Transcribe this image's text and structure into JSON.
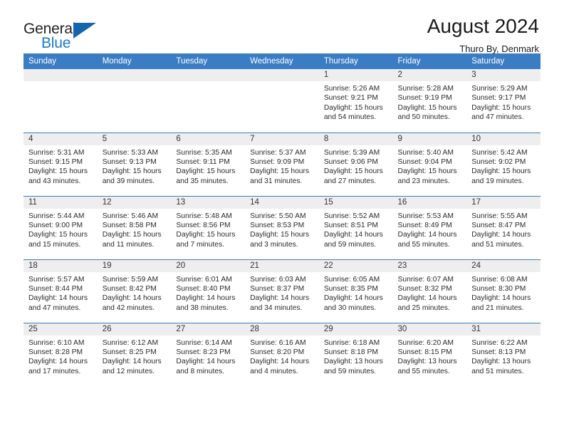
{
  "brand": {
    "name_top": "General",
    "name_bottom": "Blue",
    "accent_color": "#1c7ac9",
    "triangle_color": "#1565ad"
  },
  "header": {
    "title": "August 2024",
    "subtitle": "Thuro By, Denmark"
  },
  "calendar": {
    "header_bg": "#3b7dc4",
    "header_text_color": "#ffffff",
    "daynum_bg": "#eeeeee",
    "weekdays": [
      "Sunday",
      "Monday",
      "Tuesday",
      "Wednesday",
      "Thursday",
      "Friday",
      "Saturday"
    ],
    "weeks": [
      [
        {
          "day": "",
          "empty": true
        },
        {
          "day": "",
          "empty": true
        },
        {
          "day": "",
          "empty": true
        },
        {
          "day": "",
          "empty": true
        },
        {
          "day": "1",
          "sunrise": "Sunrise: 5:26 AM",
          "sunset": "Sunset: 9:21 PM",
          "daylight_line1": "Daylight: 15 hours",
          "daylight_line2": "and 54 minutes."
        },
        {
          "day": "2",
          "sunrise": "Sunrise: 5:28 AM",
          "sunset": "Sunset: 9:19 PM",
          "daylight_line1": "Daylight: 15 hours",
          "daylight_line2": "and 50 minutes."
        },
        {
          "day": "3",
          "sunrise": "Sunrise: 5:29 AM",
          "sunset": "Sunset: 9:17 PM",
          "daylight_line1": "Daylight: 15 hours",
          "daylight_line2": "and 47 minutes."
        }
      ],
      [
        {
          "day": "4",
          "sunrise": "Sunrise: 5:31 AM",
          "sunset": "Sunset: 9:15 PM",
          "daylight_line1": "Daylight: 15 hours",
          "daylight_line2": "and 43 minutes."
        },
        {
          "day": "5",
          "sunrise": "Sunrise: 5:33 AM",
          "sunset": "Sunset: 9:13 PM",
          "daylight_line1": "Daylight: 15 hours",
          "daylight_line2": "and 39 minutes."
        },
        {
          "day": "6",
          "sunrise": "Sunrise: 5:35 AM",
          "sunset": "Sunset: 9:11 PM",
          "daylight_line1": "Daylight: 15 hours",
          "daylight_line2": "and 35 minutes."
        },
        {
          "day": "7",
          "sunrise": "Sunrise: 5:37 AM",
          "sunset": "Sunset: 9:09 PM",
          "daylight_line1": "Daylight: 15 hours",
          "daylight_line2": "and 31 minutes."
        },
        {
          "day": "8",
          "sunrise": "Sunrise: 5:39 AM",
          "sunset": "Sunset: 9:06 PM",
          "daylight_line1": "Daylight: 15 hours",
          "daylight_line2": "and 27 minutes."
        },
        {
          "day": "9",
          "sunrise": "Sunrise: 5:40 AM",
          "sunset": "Sunset: 9:04 PM",
          "daylight_line1": "Daylight: 15 hours",
          "daylight_line2": "and 23 minutes."
        },
        {
          "day": "10",
          "sunrise": "Sunrise: 5:42 AM",
          "sunset": "Sunset: 9:02 PM",
          "daylight_line1": "Daylight: 15 hours",
          "daylight_line2": "and 19 minutes."
        }
      ],
      [
        {
          "day": "11",
          "sunrise": "Sunrise: 5:44 AM",
          "sunset": "Sunset: 9:00 PM",
          "daylight_line1": "Daylight: 15 hours",
          "daylight_line2": "and 15 minutes."
        },
        {
          "day": "12",
          "sunrise": "Sunrise: 5:46 AM",
          "sunset": "Sunset: 8:58 PM",
          "daylight_line1": "Daylight: 15 hours",
          "daylight_line2": "and 11 minutes."
        },
        {
          "day": "13",
          "sunrise": "Sunrise: 5:48 AM",
          "sunset": "Sunset: 8:56 PM",
          "daylight_line1": "Daylight: 15 hours",
          "daylight_line2": "and 7 minutes."
        },
        {
          "day": "14",
          "sunrise": "Sunrise: 5:50 AM",
          "sunset": "Sunset: 8:53 PM",
          "daylight_line1": "Daylight: 15 hours",
          "daylight_line2": "and 3 minutes."
        },
        {
          "day": "15",
          "sunrise": "Sunrise: 5:52 AM",
          "sunset": "Sunset: 8:51 PM",
          "daylight_line1": "Daylight: 14 hours",
          "daylight_line2": "and 59 minutes."
        },
        {
          "day": "16",
          "sunrise": "Sunrise: 5:53 AM",
          "sunset": "Sunset: 8:49 PM",
          "daylight_line1": "Daylight: 14 hours",
          "daylight_line2": "and 55 minutes."
        },
        {
          "day": "17",
          "sunrise": "Sunrise: 5:55 AM",
          "sunset": "Sunset: 8:47 PM",
          "daylight_line1": "Daylight: 14 hours",
          "daylight_line2": "and 51 minutes."
        }
      ],
      [
        {
          "day": "18",
          "sunrise": "Sunrise: 5:57 AM",
          "sunset": "Sunset: 8:44 PM",
          "daylight_line1": "Daylight: 14 hours",
          "daylight_line2": "and 47 minutes."
        },
        {
          "day": "19",
          "sunrise": "Sunrise: 5:59 AM",
          "sunset": "Sunset: 8:42 PM",
          "daylight_line1": "Daylight: 14 hours",
          "daylight_line2": "and 42 minutes."
        },
        {
          "day": "20",
          "sunrise": "Sunrise: 6:01 AM",
          "sunset": "Sunset: 8:40 PM",
          "daylight_line1": "Daylight: 14 hours",
          "daylight_line2": "and 38 minutes."
        },
        {
          "day": "21",
          "sunrise": "Sunrise: 6:03 AM",
          "sunset": "Sunset: 8:37 PM",
          "daylight_line1": "Daylight: 14 hours",
          "daylight_line2": "and 34 minutes."
        },
        {
          "day": "22",
          "sunrise": "Sunrise: 6:05 AM",
          "sunset": "Sunset: 8:35 PM",
          "daylight_line1": "Daylight: 14 hours",
          "daylight_line2": "and 30 minutes."
        },
        {
          "day": "23",
          "sunrise": "Sunrise: 6:07 AM",
          "sunset": "Sunset: 8:32 PM",
          "daylight_line1": "Daylight: 14 hours",
          "daylight_line2": "and 25 minutes."
        },
        {
          "day": "24",
          "sunrise": "Sunrise: 6:08 AM",
          "sunset": "Sunset: 8:30 PM",
          "daylight_line1": "Daylight: 14 hours",
          "daylight_line2": "and 21 minutes."
        }
      ],
      [
        {
          "day": "25",
          "sunrise": "Sunrise: 6:10 AM",
          "sunset": "Sunset: 8:28 PM",
          "daylight_line1": "Daylight: 14 hours",
          "daylight_line2": "and 17 minutes."
        },
        {
          "day": "26",
          "sunrise": "Sunrise: 6:12 AM",
          "sunset": "Sunset: 8:25 PM",
          "daylight_line1": "Daylight: 14 hours",
          "daylight_line2": "and 12 minutes."
        },
        {
          "day": "27",
          "sunrise": "Sunrise: 6:14 AM",
          "sunset": "Sunset: 8:23 PM",
          "daylight_line1": "Daylight: 14 hours",
          "daylight_line2": "and 8 minutes."
        },
        {
          "day": "28",
          "sunrise": "Sunrise: 6:16 AM",
          "sunset": "Sunset: 8:20 PM",
          "daylight_line1": "Daylight: 14 hours",
          "daylight_line2": "and 4 minutes."
        },
        {
          "day": "29",
          "sunrise": "Sunrise: 6:18 AM",
          "sunset": "Sunset: 8:18 PM",
          "daylight_line1": "Daylight: 13 hours",
          "daylight_line2": "and 59 minutes."
        },
        {
          "day": "30",
          "sunrise": "Sunrise: 6:20 AM",
          "sunset": "Sunset: 8:15 PM",
          "daylight_line1": "Daylight: 13 hours",
          "daylight_line2": "and 55 minutes."
        },
        {
          "day": "31",
          "sunrise": "Sunrise: 6:22 AM",
          "sunset": "Sunset: 8:13 PM",
          "daylight_line1": "Daylight: 13 hours",
          "daylight_line2": "and 51 minutes."
        }
      ]
    ]
  }
}
